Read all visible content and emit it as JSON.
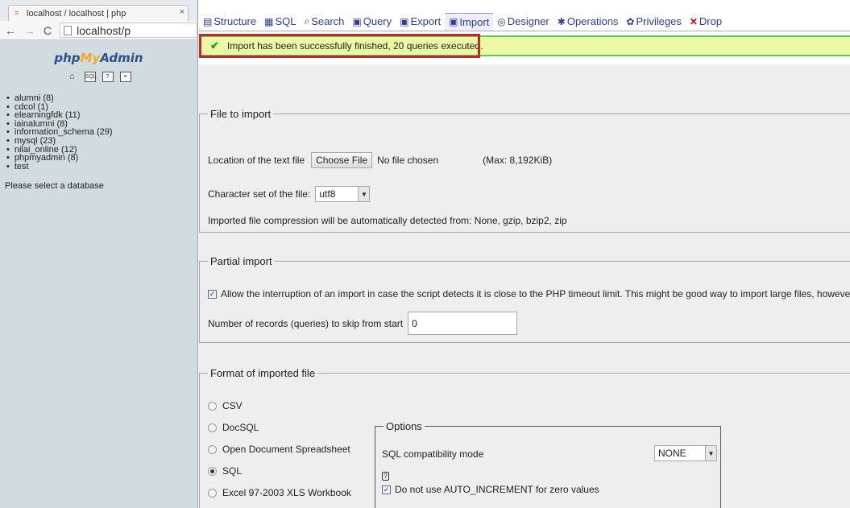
{
  "browser": {
    "tab_title": "localhost / localhost | php",
    "tab_close": "×",
    "favicon": "pma-favicon",
    "url": "localhost/p"
  },
  "sidebar": {
    "logo_php": "php",
    "logo_my": "My",
    "logo_admin": "Admin",
    "icons": [
      "home-icon",
      "sql-icon",
      "query-window-icon",
      "docs-icon"
    ],
    "databases": [
      "alumni (8)",
      "cdcol (1)",
      "elearningfdk (11)",
      "iainalumni (8)",
      "information_schema (29)",
      "mysql (23)",
      "nilai_online (12)",
      "phpmyadmin (8)",
      "test"
    ],
    "select_prompt": "Please select a database"
  },
  "topnav": {
    "tabs": [
      {
        "label": "Structure",
        "icon": "structure-icon"
      },
      {
        "label": "SQL",
        "icon": "sql-icon"
      },
      {
        "label": "Search",
        "icon": "search-icon"
      },
      {
        "label": "Query",
        "icon": "query-icon"
      },
      {
        "label": "Export",
        "icon": "export-icon"
      },
      {
        "label": "Import",
        "icon": "import-icon",
        "active": true
      },
      {
        "label": "Designer",
        "icon": "designer-icon"
      },
      {
        "label": "Operations",
        "icon": "operations-icon"
      },
      {
        "label": "Privileges",
        "icon": "privileges-icon"
      },
      {
        "label": "Drop",
        "icon": "drop-icon"
      }
    ]
  },
  "message": {
    "text": "Import has been successfully finished, 20 queries executed.",
    "icon": "check-icon",
    "highlight_color": "#c1272d"
  },
  "file_to_import": {
    "legend": "File to import",
    "location_label": "Location of the text file",
    "choose_button": "Choose File",
    "no_file": "No file chosen",
    "max_size": "(Max: 8,192KiB)",
    "charset_label": "Character set of the file:",
    "charset_value": "utf8",
    "compression_note": "Imported file compression will be automatically detected from: None, gzip, bzip2, zip"
  },
  "partial_import": {
    "legend": "Partial import",
    "allow_interrupt": "Allow the interruption of an import in case the script detects it is close to the PHP timeout limit. This might be good way to import large files, however it c",
    "allow_checked": true,
    "skip_label": "Number of records (queries) to skip from start",
    "skip_value": "0"
  },
  "format": {
    "legend": "Format of imported file",
    "options": [
      {
        "label": "CSV",
        "checked": false
      },
      {
        "label": "DocSQL",
        "checked": false
      },
      {
        "label": "Open Document Spreadsheet",
        "checked": false
      },
      {
        "label": "SQL",
        "checked": true
      },
      {
        "label": "Excel 97-2003 XLS Workbook",
        "checked": false
      }
    ],
    "options_legend": "Options",
    "compat_label": "SQL compatibility mode",
    "compat_value": "NONE",
    "auto_increment_label": "Do not use AUTO_INCREMENT for zero values",
    "auto_increment_checked": true
  },
  "colors": {
    "success_bg": "#ebf8a4",
    "success_border": "#5cc95c",
    "sidebar_bg": "#d0dce0",
    "link": "#2b3d97"
  }
}
